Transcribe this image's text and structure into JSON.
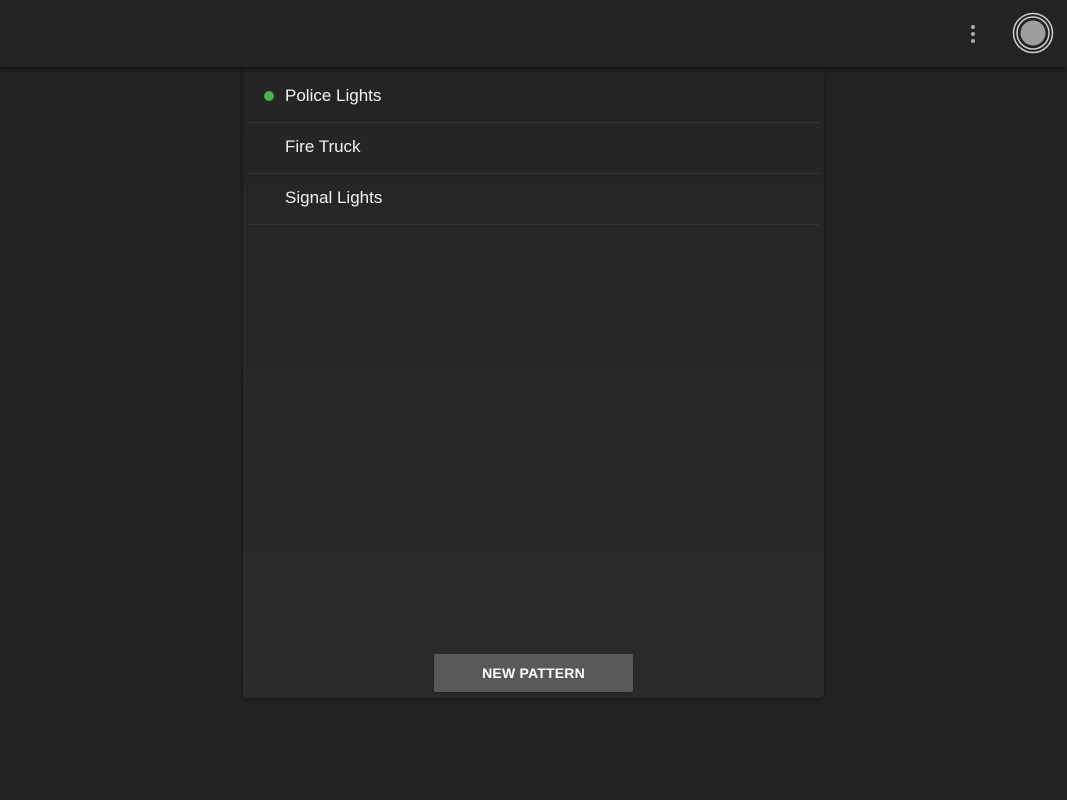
{
  "toolbar": {
    "overflow_icon": "more-vert-icon",
    "power_icon": "power-toggle-icon"
  },
  "patterns": {
    "items": [
      {
        "label": "Police Lights",
        "active": true
      },
      {
        "label": "Fire Truck",
        "active": false
      },
      {
        "label": "Signal Lights",
        "active": false
      }
    ]
  },
  "actions": {
    "new_pattern_label": "NEW PATTERN"
  },
  "colors": {
    "background": "#222222",
    "toolbar": "#232323",
    "panel": "#262626",
    "active_indicator": "#4caf50",
    "button": "#595959",
    "text": "#f2f2f2"
  }
}
